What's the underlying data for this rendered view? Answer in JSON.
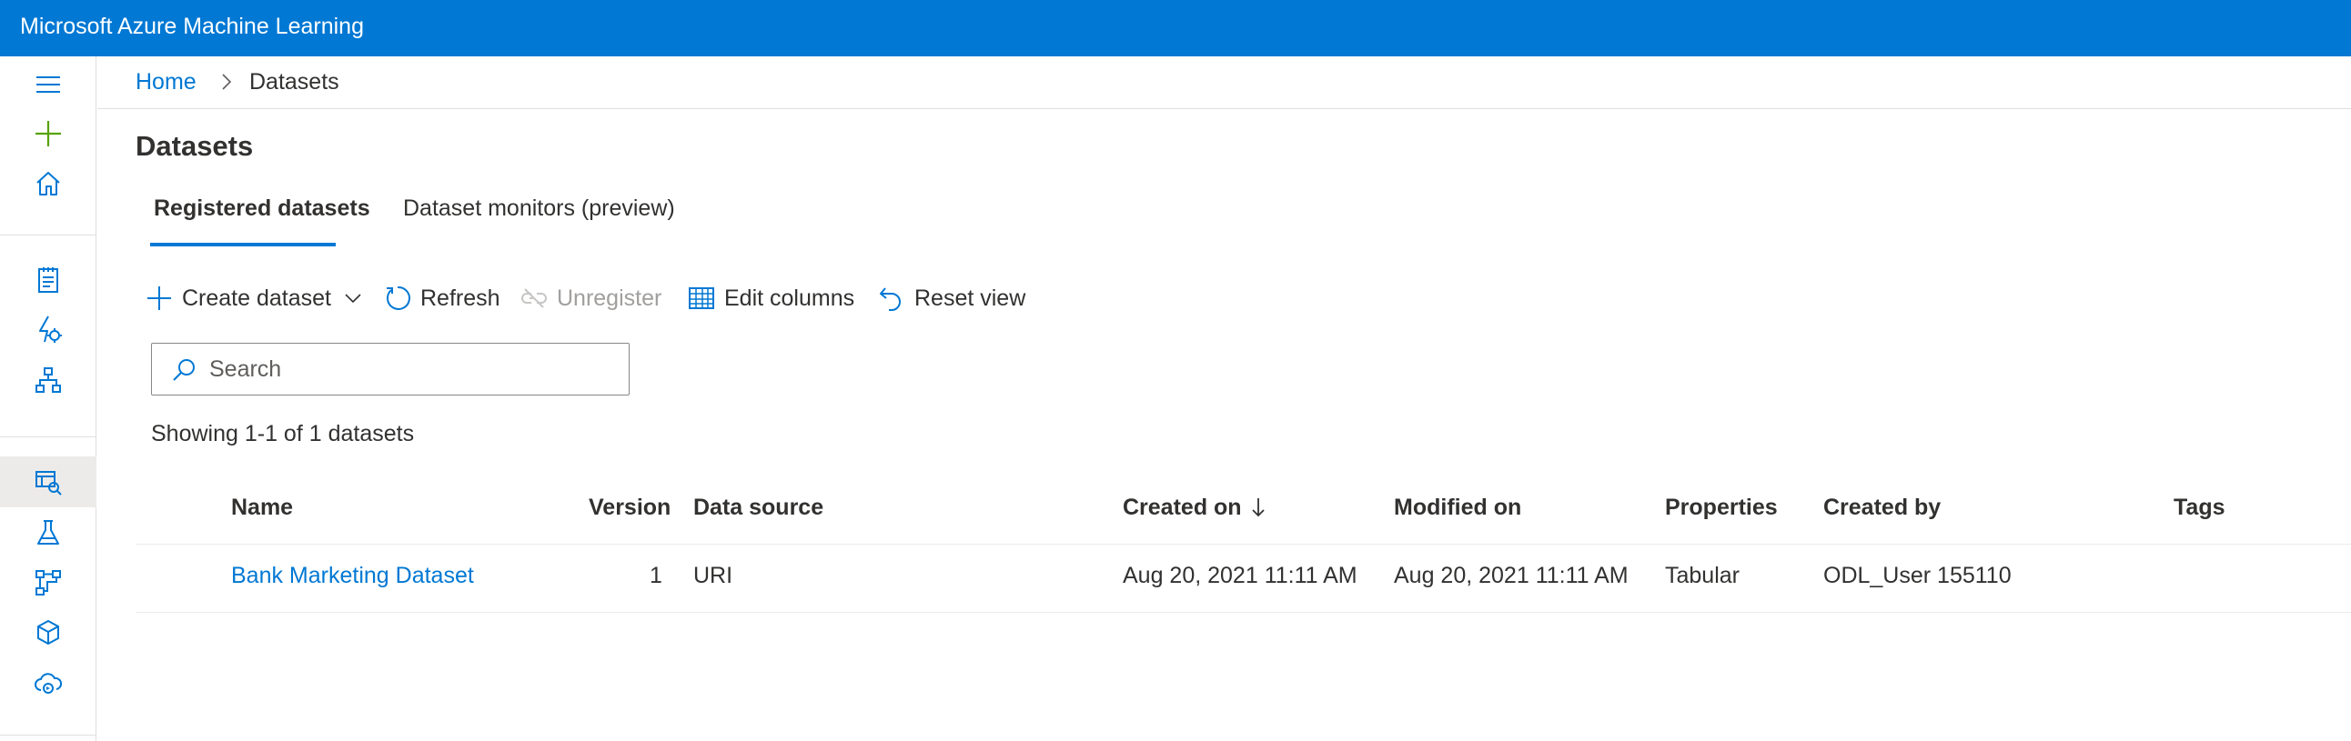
{
  "app": {
    "title": "Microsoft Azure Machine Learning"
  },
  "nav": {
    "items": [
      {
        "icon": "hamburger-menu-icon"
      },
      {
        "icon": "plus-icon"
      },
      {
        "icon": "home-icon"
      },
      {
        "icon": "notebook-icon"
      },
      {
        "icon": "automated-ml-icon"
      },
      {
        "icon": "designer-icon"
      },
      {
        "icon": "datasets-icon",
        "active": true
      },
      {
        "icon": "experiments-flask-icon"
      },
      {
        "icon": "pipelines-icon"
      },
      {
        "icon": "models-cube-icon"
      },
      {
        "icon": "endpoints-icon"
      }
    ]
  },
  "breadcrumb": {
    "home": "Home",
    "current": "Datasets"
  },
  "page": {
    "title": "Datasets"
  },
  "tabs": [
    {
      "label": "Registered datasets",
      "selected": true
    },
    {
      "label": "Dataset monitors (preview)",
      "selected": false
    }
  ],
  "toolbar": {
    "create": "Create dataset",
    "refresh": "Refresh",
    "unregister": "Unregister",
    "edit_columns": "Edit columns",
    "reset_view": "Reset view"
  },
  "search": {
    "placeholder": "Search",
    "value": ""
  },
  "summary": "Showing 1-1 of 1 datasets",
  "table": {
    "columns": [
      "Name",
      "Version",
      "Data source",
      "Created on",
      "Modified on",
      "Properties",
      "Created by",
      "Tags"
    ],
    "sort": {
      "column": "Created on",
      "direction": "descending"
    },
    "rows": [
      {
        "name": "Bank Marketing Dataset",
        "version": "1",
        "data_source": "URI",
        "created_on": "Aug 20, 2021 11:11 AM",
        "modified_on": "Aug 20, 2021 11:11 AM",
        "properties": "Tabular",
        "created_by": "ODL_User 155110",
        "tags": ""
      }
    ]
  },
  "colors": {
    "brand": "#0078d4",
    "plus_icon": "#57a300",
    "text": "#323130",
    "disabled": "#a19f9d",
    "selected_nav_bg": "#edebe9"
  }
}
